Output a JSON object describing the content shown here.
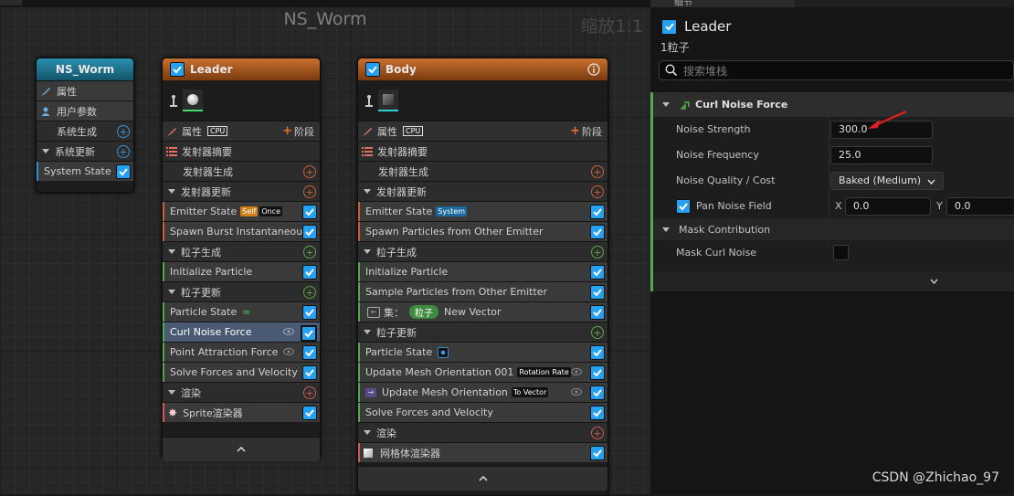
{
  "graph": {
    "title": "NS_Worm",
    "zoom": "缩放1:1"
  },
  "system_node": {
    "title": "NS_Worm",
    "rows": {
      "properties": "属性",
      "user_params": "用户参数",
      "system_spawn": "系统生成",
      "system_update": "系统更新",
      "system_state": "System State"
    }
  },
  "leader_node": {
    "title": "Leader",
    "properties": "属性",
    "cpu": "CPU",
    "stage": "阶段",
    "emitter_summary": "发射器摘要",
    "emitter_spawn": "发射器生成",
    "emitter_update": "发射器更新",
    "emitter_state": "Emitter State",
    "tag_self": "Self",
    "tag_once": "Once",
    "spawn_burst": "Spawn Burst Instantaneous",
    "particle_spawn": "粒子生成",
    "initialize_particle": "Initialize Particle",
    "particle_update": "粒子更新",
    "particle_state": "Particle State",
    "curl_noise": "Curl Noise Force",
    "point_attraction": "Point Attraction Force",
    "solve_forces": "Solve Forces and Velocity",
    "render": "渲染",
    "sprite_renderer": "Sprite渲染器"
  },
  "body_node": {
    "title": "Body",
    "properties": "属性",
    "cpu": "CPU",
    "stage": "阶段",
    "emitter_summary": "发射器摘要",
    "emitter_spawn": "发射器生成",
    "emitter_update": "发射器更新",
    "emitter_state": "Emitter State",
    "tag_system": "System",
    "spawn_from_other": "Spawn Particles from Other Emitter",
    "particle_spawn": "粒子生成",
    "initialize_particle": "Initialize Particle",
    "sample_particles": "Sample Particles from Other Emitter",
    "set_label": "集：",
    "set_badge": "粒子",
    "new_vector": "New Vector",
    "particle_update": "粒子更新",
    "particle_state": "Particle State",
    "update_mesh_001": "Update Mesh Orientation 001",
    "tag_rotation_rate": "Rotation Rate",
    "update_mesh": "Update Mesh Orientation",
    "tag_to_vector": "To Vector",
    "solve_forces": "Solve Forces and Velocity",
    "render": "渲染",
    "mesh_renderer": "网格体渲染器"
  },
  "details": {
    "tab_title": "细节",
    "emitter_name": "Leader",
    "particle_count": "1粒子",
    "search_placeholder": "搜索堆栈",
    "section_title": "Curl Noise Force",
    "noise_strength_label": "Noise Strength",
    "noise_strength_value": "300.0",
    "noise_frequency_label": "Noise Frequency",
    "noise_frequency_value": "25.0",
    "noise_quality_label": "Noise Quality / Cost",
    "noise_quality_value": "Baked (Medium)",
    "pan_noise_label": "Pan Noise Field",
    "pan_x_label": "X",
    "pan_x_value": "0.0",
    "pan_y_label": "Y",
    "pan_y_value": "0.0",
    "mask_section": "Mask Contribution",
    "mask_curl_label": "Mask Curl Noise"
  },
  "watermark": "CSDN @Zhichao_97",
  "colors": {
    "checkbox": "#26a0f0",
    "system_header": "#1f6e86",
    "emitter_header": "#b25a1e",
    "spawn_plus": "#c8603a",
    "particle_plus": "#5aa84a",
    "render_plus": "#d05a5a",
    "module_bar_green": "#56a84e",
    "arrow": "#e02020"
  }
}
